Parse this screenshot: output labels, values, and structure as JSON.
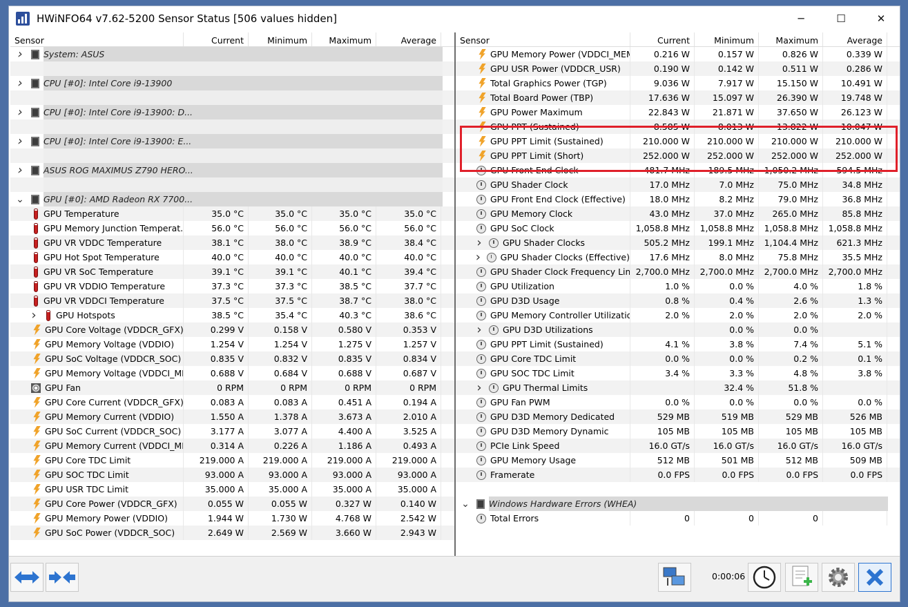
{
  "window": {
    "title": "HWiNFO64 v7.62-5200 Sensor Status [506 values hidden]",
    "minimize_glyph": "─",
    "maximize_glyph": "☐",
    "close_glyph": "✕"
  },
  "columns": {
    "sensor": "Sensor",
    "current": "Current",
    "minimum": "Minimum",
    "maximum": "Maximum",
    "average": "Average"
  },
  "left_rows": [
    {
      "type": "group",
      "name": "System: ASUS"
    },
    {
      "type": "blank"
    },
    {
      "type": "group",
      "name": "CPU [#0]: Intel Core i9-13900"
    },
    {
      "type": "blank"
    },
    {
      "type": "group",
      "name": "CPU [#0]: Intel Core i9-13900: D..."
    },
    {
      "type": "blank"
    },
    {
      "type": "group",
      "name": "CPU [#0]: Intel Core i9-13900: E..."
    },
    {
      "type": "blank"
    },
    {
      "type": "group",
      "name": "ASUS ROG MAXIMUS Z790 HERO..."
    },
    {
      "type": "blank"
    },
    {
      "type": "group",
      "name": "GPU [#0]: AMD Radeon RX 7700...",
      "expanded": true
    },
    {
      "icon": "therm",
      "name": "GPU Temperature",
      "cur": "35.0 °C",
      "min": "35.0 °C",
      "max": "35.0 °C",
      "avg": "35.0 °C"
    },
    {
      "icon": "therm",
      "name": "GPU Memory Junction Temperat...",
      "cur": "56.0 °C",
      "min": "56.0 °C",
      "max": "56.0 °C",
      "avg": "56.0 °C"
    },
    {
      "icon": "therm",
      "name": "GPU VR VDDC Temperature",
      "cur": "38.1 °C",
      "min": "38.0 °C",
      "max": "38.9 °C",
      "avg": "38.4 °C"
    },
    {
      "icon": "therm",
      "name": "GPU Hot Spot Temperature",
      "cur": "40.0 °C",
      "min": "40.0 °C",
      "max": "40.0 °C",
      "avg": "40.0 °C"
    },
    {
      "icon": "therm",
      "name": "GPU VR SoC Temperature",
      "cur": "39.1 °C",
      "min": "39.1 °C",
      "max": "40.1 °C",
      "avg": "39.4 °C"
    },
    {
      "icon": "therm",
      "name": "GPU VR VDDIO Temperature",
      "cur": "37.3 °C",
      "min": "37.3 °C",
      "max": "38.5 °C",
      "avg": "37.7 °C"
    },
    {
      "icon": "therm",
      "name": "GPU VR VDDCI Temperature",
      "cur": "37.5 °C",
      "min": "37.5 °C",
      "max": "38.7 °C",
      "avg": "38.0 °C"
    },
    {
      "icon": "therm",
      "name": "GPU Hotspots",
      "sub": true,
      "cur": "38.5 °C",
      "min": "35.4 °C",
      "max": "40.3 °C",
      "avg": "38.6 °C"
    },
    {
      "icon": "bolt",
      "name": "GPU Core Voltage (VDDCR_GFX)",
      "cur": "0.299 V",
      "min": "0.158 V",
      "max": "0.580 V",
      "avg": "0.353 V"
    },
    {
      "icon": "bolt",
      "name": "GPU Memory Voltage (VDDIO)",
      "cur": "1.254 V",
      "min": "1.254 V",
      "max": "1.275 V",
      "avg": "1.257 V"
    },
    {
      "icon": "bolt",
      "name": "GPU SoC Voltage (VDDCR_SOC)",
      "cur": "0.835 V",
      "min": "0.832 V",
      "max": "0.835 V",
      "avg": "0.834 V"
    },
    {
      "icon": "bolt",
      "name": "GPU Memory Voltage (VDDCI_ME...",
      "cur": "0.688 V",
      "min": "0.684 V",
      "max": "0.688 V",
      "avg": "0.687 V"
    },
    {
      "icon": "fan",
      "name": "GPU Fan",
      "cur": "0 RPM",
      "min": "0 RPM",
      "max": "0 RPM",
      "avg": "0 RPM"
    },
    {
      "icon": "bolt",
      "name": "GPU Core Current (VDDCR_GFX)",
      "cur": "0.083 A",
      "min": "0.083 A",
      "max": "0.451 A",
      "avg": "0.194 A"
    },
    {
      "icon": "bolt",
      "name": "GPU Memory Current (VDDIO)",
      "cur": "1.550 A",
      "min": "1.378 A",
      "max": "3.673 A",
      "avg": "2.010 A"
    },
    {
      "icon": "bolt",
      "name": "GPU SoC Current (VDDCR_SOC)",
      "cur": "3.177 A",
      "min": "3.077 A",
      "max": "4.400 A",
      "avg": "3.525 A"
    },
    {
      "icon": "bolt",
      "name": "GPU Memory Current (VDDCI_ME...",
      "cur": "0.314 A",
      "min": "0.226 A",
      "max": "1.186 A",
      "avg": "0.493 A"
    },
    {
      "icon": "bolt",
      "name": "GPU Core TDC Limit",
      "cur": "219.000 A",
      "min": "219.000 A",
      "max": "219.000 A",
      "avg": "219.000 A"
    },
    {
      "icon": "bolt",
      "name": "GPU SOC TDC Limit",
      "cur": "93.000 A",
      "min": "93.000 A",
      "max": "93.000 A",
      "avg": "93.000 A"
    },
    {
      "icon": "bolt",
      "name": "GPU USR TDC Limit",
      "cur": "35.000 A",
      "min": "35.000 A",
      "max": "35.000 A",
      "avg": "35.000 A"
    },
    {
      "icon": "bolt",
      "name": "GPU Core Power (VDDCR_GFX)",
      "cur": "0.055 W",
      "min": "0.055 W",
      "max": "0.327 W",
      "avg": "0.140 W"
    },
    {
      "icon": "bolt",
      "name": "GPU Memory Power (VDDIO)",
      "cur": "1.944 W",
      "min": "1.730 W",
      "max": "4.768 W",
      "avg": "2.542 W"
    },
    {
      "icon": "bolt",
      "name": "GPU SoC Power (VDDCR_SOC)",
      "cur": "2.649 W",
      "min": "2.569 W",
      "max": "3.660 W",
      "avg": "2.943 W"
    }
  ],
  "right_rows": [
    {
      "icon": "bolt",
      "name": "GPU Memory Power (VDDCI_MEM)",
      "cur": "0.216 W",
      "min": "0.157 W",
      "max": "0.826 W",
      "avg": "0.339 W"
    },
    {
      "icon": "bolt",
      "name": "GPU USR Power (VDDCR_USR)",
      "cur": "0.190 W",
      "min": "0.142 W",
      "max": "0.511 W",
      "avg": "0.286 W"
    },
    {
      "icon": "bolt",
      "name": "Total Graphics Power (TGP)",
      "cur": "9.036 W",
      "min": "7.917 W",
      "max": "15.150 W",
      "avg": "10.491 W"
    },
    {
      "icon": "bolt",
      "name": "Total Board Power (TBP)",
      "cur": "17.636 W",
      "min": "15.097 W",
      "max": "26.390 W",
      "avg": "19.748 W"
    },
    {
      "icon": "bolt",
      "name": "GPU Power Maximum",
      "cur": "22.843 W",
      "min": "21.871 W",
      "max": "37.650 W",
      "avg": "26.123 W"
    },
    {
      "icon": "bolt",
      "name": "GPU PPT (Sustained)",
      "cur": "8.585 W",
      "min": "8.013 W",
      "max": "13.822 W",
      "avg": "10.047 W"
    },
    {
      "icon": "bolt",
      "name": "GPU PPT Limit (Sustained)",
      "cur": "210.000 W",
      "min": "210.000 W",
      "max": "210.000 W",
      "avg": "210.000 W"
    },
    {
      "icon": "bolt",
      "name": "GPU PPT Limit (Short)",
      "cur": "252.000 W",
      "min": "252.000 W",
      "max": "252.000 W",
      "avg": "252.000 W"
    },
    {
      "icon": "clock",
      "name": "GPU Front End Clock",
      "cur": "481.7 MHz",
      "min": "189.5 MHz",
      "max": "1,050.2 MHz",
      "avg": "594.5 MHz"
    },
    {
      "icon": "clock",
      "name": "GPU Shader Clock",
      "cur": "17.0 MHz",
      "min": "7.0 MHz",
      "max": "75.0 MHz",
      "avg": "34.8 MHz"
    },
    {
      "icon": "clock",
      "name": "GPU Front End Clock (Effective)",
      "cur": "18.0 MHz",
      "min": "8.2 MHz",
      "max": "79.0 MHz",
      "avg": "36.8 MHz"
    },
    {
      "icon": "clock",
      "name": "GPU Memory Clock",
      "cur": "43.0 MHz",
      "min": "37.0 MHz",
      "max": "265.0 MHz",
      "avg": "85.8 MHz"
    },
    {
      "icon": "clock",
      "name": "GPU SoC Clock",
      "cur": "1,058.8 MHz",
      "min": "1,058.8 MHz",
      "max": "1,058.8 MHz",
      "avg": "1,058.8 MHz"
    },
    {
      "icon": "clock",
      "name": "GPU Shader Clocks",
      "sub": true,
      "cur": "505.2 MHz",
      "min": "199.1 MHz",
      "max": "1,104.4 MHz",
      "avg": "621.3 MHz"
    },
    {
      "icon": "clock",
      "name": "GPU Shader Clocks (Effective)",
      "sub": true,
      "cur": "17.6 MHz",
      "min": "8.0 MHz",
      "max": "75.8 MHz",
      "avg": "35.5 MHz"
    },
    {
      "icon": "clock",
      "name": "GPU Shader Clock Frequency Limit",
      "cur": "2,700.0 MHz",
      "min": "2,700.0 MHz",
      "max": "2,700.0 MHz",
      "avg": "2,700.0 MHz"
    },
    {
      "icon": "clock",
      "name": "GPU Utilization",
      "cur": "1.0 %",
      "min": "0.0 %",
      "max": "4.0 %",
      "avg": "1.8 %"
    },
    {
      "icon": "clock",
      "name": "GPU D3D Usage",
      "cur": "0.8 %",
      "min": "0.4 %",
      "max": "2.6 %",
      "avg": "1.3 %"
    },
    {
      "icon": "clock",
      "name": "GPU Memory Controller Utilization",
      "cur": "2.0 %",
      "min": "2.0 %",
      "max": "2.0 %",
      "avg": "2.0 %"
    },
    {
      "icon": "clock",
      "name": "GPU D3D Utilizations",
      "sub": true,
      "cur": "",
      "min": "0.0 %",
      "max": "0.0 %",
      "avg": ""
    },
    {
      "icon": "clock",
      "name": "GPU PPT Limit (Sustained)",
      "cur": "4.1 %",
      "min": "3.8 %",
      "max": "7.4 %",
      "avg": "5.1 %"
    },
    {
      "icon": "clock",
      "name": "GPU Core TDC Limit",
      "cur": "0.0 %",
      "min": "0.0 %",
      "max": "0.2 %",
      "avg": "0.1 %"
    },
    {
      "icon": "clock",
      "name": "GPU SOC TDC Limit",
      "cur": "3.4 %",
      "min": "3.3 %",
      "max": "4.8 %",
      "avg": "3.8 %"
    },
    {
      "icon": "clock",
      "name": "GPU Thermal Limits",
      "sub": true,
      "cur": "",
      "min": "32.4 %",
      "max": "51.8 %",
      "avg": ""
    },
    {
      "icon": "clock",
      "name": "GPU Fan PWM",
      "cur": "0.0 %",
      "min": "0.0 %",
      "max": "0.0 %",
      "avg": "0.0 %"
    },
    {
      "icon": "clock",
      "name": "GPU D3D Memory Dedicated",
      "cur": "529 MB",
      "min": "519 MB",
      "max": "529 MB",
      "avg": "526 MB"
    },
    {
      "icon": "clock",
      "name": "GPU D3D Memory Dynamic",
      "cur": "105 MB",
      "min": "105 MB",
      "max": "105 MB",
      "avg": "105 MB"
    },
    {
      "icon": "clock",
      "name": "PCIe Link Speed",
      "cur": "16.0 GT/s",
      "min": "16.0 GT/s",
      "max": "16.0 GT/s",
      "avg": "16.0 GT/s"
    },
    {
      "icon": "clock",
      "name": "GPU Memory Usage",
      "cur": "512 MB",
      "min": "501 MB",
      "max": "512 MB",
      "avg": "509 MB"
    },
    {
      "icon": "clock",
      "name": "Framerate",
      "cur": "0.0 FPS",
      "min": "0.0 FPS",
      "max": "0.0 FPS",
      "avg": "0.0 FPS"
    },
    {
      "type": "blank"
    },
    {
      "type": "group",
      "name": "Windows Hardware Errors (WHEA)",
      "expanded": true,
      "nested": true
    },
    {
      "icon": "clock",
      "name": "Total Errors",
      "cur": "0",
      "min": "0",
      "max": "0",
      "avg": ""
    }
  ],
  "footer": {
    "timer": "0:00:06"
  },
  "colors": {
    "highlight": "#e0202a",
    "group_bar": "#d9d9d9",
    "accent": "#2d74d0"
  },
  "toolbar_icons": [
    "expand-arrows-icon",
    "collapse-arrows-icon",
    "network-icon",
    "clock-icon",
    "report-icon",
    "settings-gear-icon",
    "close-x-icon"
  ]
}
